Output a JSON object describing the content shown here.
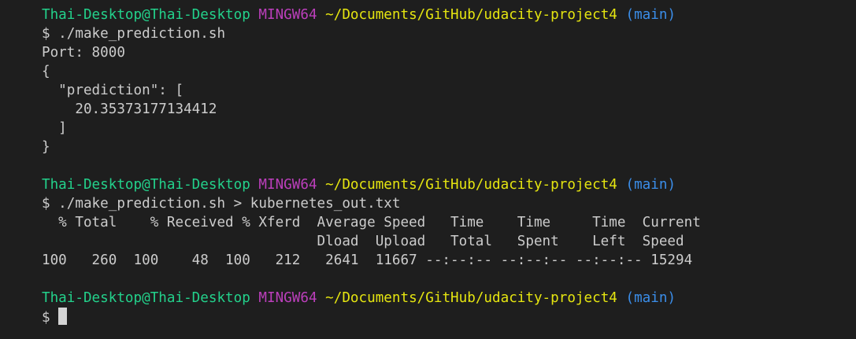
{
  "prompt": {
    "user_host": "Thai-Desktop@Thai-Desktop",
    "system": "MINGW64",
    "path": "~/Documents/GitHub/udacity-project4",
    "branch": "(main)"
  },
  "block1": {
    "command": "$ ./make_prediction.sh",
    "output": [
      "Port: 8000",
      "{",
      "  \"prediction\": [",
      "    20.35373177134412",
      "  ]",
      "}"
    ]
  },
  "block2": {
    "command": "$ ./make_prediction.sh > kubernetes_out.txt",
    "curl_header_1": "  % Total    % Received % Xferd  Average Speed   Time    Time     Time  Current",
    "curl_header_2": "                                 Dload  Upload   Total   Spent    Left  Speed",
    "curl_row": "100   260  100    48  100   212   2641  11667 --:--:-- --:--:-- --:--:-- 15294"
  },
  "block3": {
    "prompt_symbol": "$"
  }
}
